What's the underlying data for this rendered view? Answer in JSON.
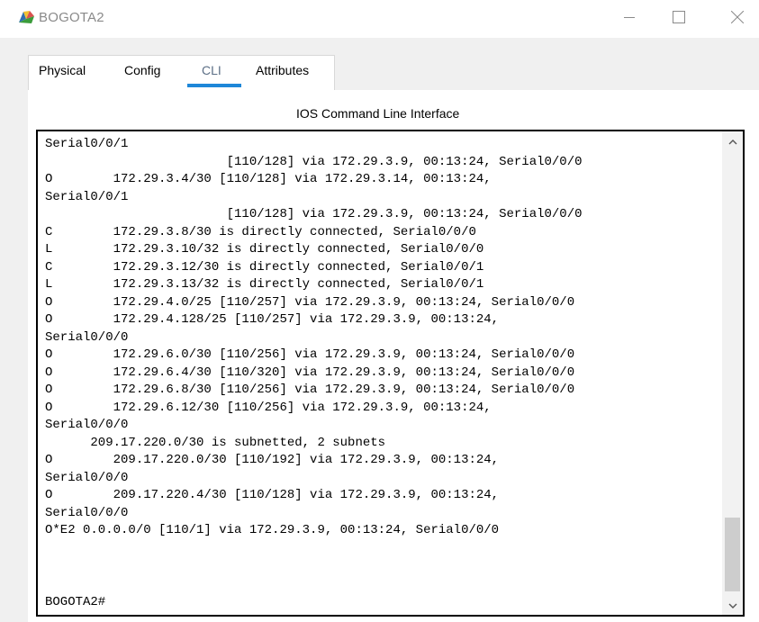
{
  "window": {
    "title": "BOGOTA2",
    "icons": {
      "app": "packet-tracer-router-icon",
      "minimize": "minimize-icon",
      "maximize": "maximize-icon",
      "close": "close-icon"
    }
  },
  "tabs": [
    {
      "label": "Physical",
      "active": false
    },
    {
      "label": "Config",
      "active": false
    },
    {
      "label": "CLI",
      "active": true
    },
    {
      "label": "Attributes",
      "active": false
    }
  ],
  "cli": {
    "heading": "IOS Command Line Interface",
    "lines": [
      "Serial0/0/1",
      "                        [110/128] via 172.29.3.9, 00:13:24, Serial0/0/0",
      "O        172.29.3.4/30 [110/128] via 172.29.3.14, 00:13:24,",
      "Serial0/0/1",
      "                        [110/128] via 172.29.3.9, 00:13:24, Serial0/0/0",
      "C        172.29.3.8/30 is directly connected, Serial0/0/0",
      "L        172.29.3.10/32 is directly connected, Serial0/0/0",
      "C        172.29.3.12/30 is directly connected, Serial0/0/1",
      "L        172.29.3.13/32 is directly connected, Serial0/0/1",
      "O        172.29.4.0/25 [110/257] via 172.29.3.9, 00:13:24, Serial0/0/0",
      "O        172.29.4.128/25 [110/257] via 172.29.3.9, 00:13:24,",
      "Serial0/0/0",
      "O        172.29.6.0/30 [110/256] via 172.29.3.9, 00:13:24, Serial0/0/0",
      "O        172.29.6.4/30 [110/320] via 172.29.3.9, 00:13:24, Serial0/0/0",
      "O        172.29.6.8/30 [110/256] via 172.29.3.9, 00:13:24, Serial0/0/0",
      "O        172.29.6.12/30 [110/256] via 172.29.3.9, 00:13:24,",
      "Serial0/0/0",
      "      209.17.220.0/30 is subnetted, 2 subnets",
      "O        209.17.220.0/30 [110/192] via 172.29.3.9, 00:13:24,",
      "Serial0/0/0",
      "O        209.17.220.4/30 [110/128] via 172.29.3.9, 00:13:24,",
      "Serial0/0/0",
      "O*E2 0.0.0.0/0 [110/1] via 172.29.3.9, 00:13:24, Serial0/0/0"
    ],
    "prompt": "BOGOTA2#",
    "icons": {
      "scroll_up": "chevron-up-icon",
      "scroll_down": "chevron-down-icon"
    }
  },
  "colors": {
    "active_tab_underline": "#1e87d8",
    "active_tab_text": "#5c6f86",
    "title_text": "#8a8a8a",
    "scroll_thumb": "#cdcdcd"
  }
}
